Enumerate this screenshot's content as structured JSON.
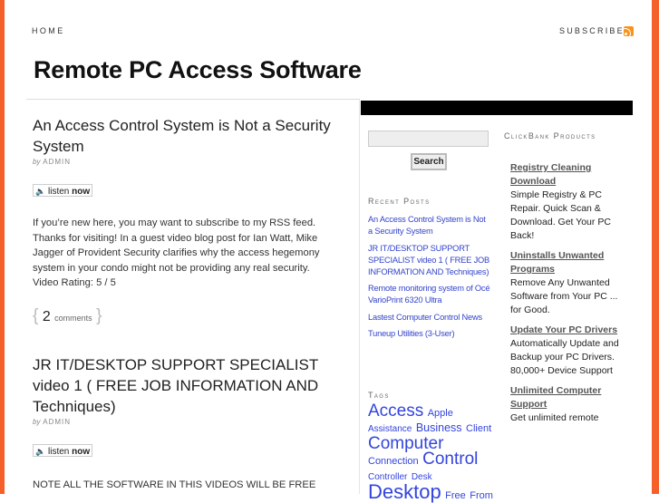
{
  "nav": {
    "home": "HOME",
    "subscribe": "SUBSCRIBE",
    "rss_icon": "rss-feed-icon"
  },
  "site": {
    "title": "Remote PC Access Software"
  },
  "colors": {
    "accent_border": "#f55f2a",
    "link": "#3344cc"
  },
  "posts": [
    {
      "title": "An Access Control System is Not a Security System",
      "by": "by",
      "author": "ADMIN",
      "listen_label": "listen",
      "listen_bold": "now",
      "body": "If you’re new here, you may want to subscribe to my RSS feed. Thanks for visiting! In a guest video blog post for Ian Watt, Mike Jagger of Provident Security clarifies why the access hegemony system in your condo might not be providing any real security. Video Rating: 5 / 5",
      "comment_count": "2",
      "comment_label": "comments"
    },
    {
      "title": "JR IT/DESKTOP SUPPORT SPECIALIST video 1 ( FREE JOB INFORMATION AND Techniques)",
      "by": "by",
      "author": "ADMIN",
      "listen_label": "listen",
      "listen_bold": "now",
      "body": "NOTE ALL THE SOFTWARE IN THIS VIDEOS WILL BE FREE"
    }
  ],
  "sidebar": {
    "search": {
      "value": "",
      "button": "Search"
    },
    "recent_posts": {
      "title": "Recent Posts",
      "items": [
        "An Access Control System is Not a Security System",
        "JR IT/DESKTOP SUPPORT SPECIALIST video 1 ( FREE JOB INFORMATION AND Techniques)",
        "Remote monitoring system of Océ VarioPrint 6320 Ultra",
        "Lastest Computer Control News",
        "Tuneup Utilities (3-User)"
      ]
    },
    "tags": {
      "title": "Tags",
      "items": [
        {
          "label": "Access",
          "size": "xl"
        },
        {
          "label": "Apple",
          "size": "s"
        },
        {
          "label": "Assistance",
          "size": "xs"
        },
        {
          "label": "Business",
          "size": "m"
        },
        {
          "label": "Client",
          "size": "s"
        },
        {
          "label": "Computer",
          "size": "xl"
        },
        {
          "label": "Connection",
          "size": "s"
        },
        {
          "label": "Control",
          "size": "xl"
        },
        {
          "label": "Controller",
          "size": "xs"
        },
        {
          "label": "Desk",
          "size": "xs"
        },
        {
          "label": "Desktop",
          "size": "xxl"
        },
        {
          "label": "Free",
          "size": "s"
        },
        {
          "label": "From",
          "size": "s"
        }
      ]
    },
    "clickbank": {
      "title": "ClickBank Products",
      "items": [
        {
          "title": "Registry Cleaning Download",
          "desc": "Simple Registry & PC Repair. Quick Scan & Download. Get Your PC Back!"
        },
        {
          "title": "Uninstalls Unwanted Programs",
          "desc": "Remove Any Unwanted Software from Your PC ... for Good."
        },
        {
          "title": "Update Your PC Drivers",
          "desc": "Automatically Update and Backup your PC Drivers. 80,000+ Device Support"
        },
        {
          "title": "Unlimited Computer Support",
          "desc": "Get unlimited remote"
        }
      ]
    }
  }
}
